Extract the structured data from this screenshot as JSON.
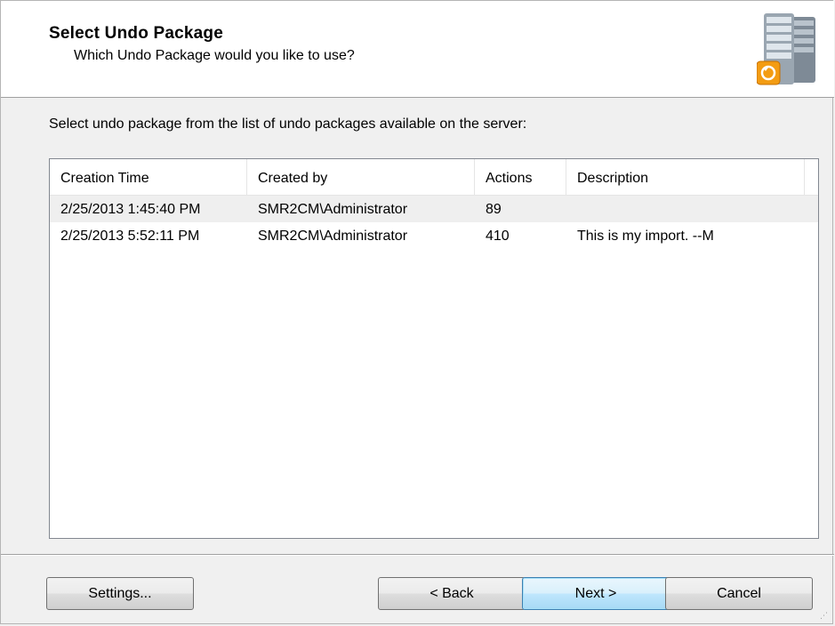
{
  "header": {
    "title": "Select Undo Package",
    "subtitle": "Which Undo Package would you like to use?",
    "icon": "server-restore-icon"
  },
  "prompt": "Select undo package from the list of undo packages available on the server:",
  "list": {
    "columns": [
      "Creation Time",
      "Created by",
      "Actions",
      "Description"
    ],
    "rows": [
      {
        "time": "2/25/2013 1:45:40 PM",
        "created_by": "SMR2CM\\Administrator",
        "actions": "89",
        "description": "",
        "selected": true
      },
      {
        "time": "2/25/2013 5:52:11 PM",
        "created_by": "SMR2CM\\Administrator",
        "actions": "410",
        "description": "This is my import. --M",
        "selected": false
      }
    ]
  },
  "buttons": {
    "settings": "Settings...",
    "back": "< Back",
    "next": "Next >",
    "cancel": "Cancel"
  },
  "colors": {
    "accent": "#3c7fb1",
    "icon_orange": "#f39c12"
  }
}
